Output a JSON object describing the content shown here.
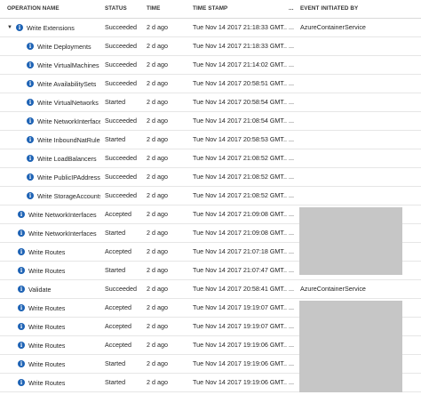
{
  "columns": {
    "operation_name": "OPERATION NAME",
    "status": "STATUS",
    "time": "TIME",
    "time_stamp": "TIME STAMP",
    "more": "...",
    "event_initiated_by": "EVENT INITIATED BY"
  },
  "rows": [
    {
      "op": "Write Extensions",
      "status": "Succeeded",
      "time": "2 d ago",
      "stamp": "Tue Nov 14 2017 21:18:33 GMT...",
      "dots": "...",
      "by": "AzureContainerService"
    },
    {
      "op": "Write Deployments",
      "status": "Succeeded",
      "time": "2 d ago",
      "stamp": "Tue Nov 14 2017 21:18:33 GMT...",
      "dots": "...",
      "by": ""
    },
    {
      "op": "Write VirtualMachines",
      "status": "Succeeded",
      "time": "2 d ago",
      "stamp": "Tue Nov 14 2017 21:14:02 GMT...",
      "dots": "...",
      "by": ""
    },
    {
      "op": "Write AvailabilitySets",
      "status": "Succeeded",
      "time": "2 d ago",
      "stamp": "Tue Nov 14 2017 20:58:51 GMT...",
      "dots": "...",
      "by": ""
    },
    {
      "op": "Write VirtualNetworks",
      "status": "Started",
      "time": "2 d ago",
      "stamp": "Tue Nov 14 2017 20:58:54 GMT...",
      "dots": "...",
      "by": ""
    },
    {
      "op": "Write NetworkInterfaces",
      "status": "Succeeded",
      "time": "2 d ago",
      "stamp": "Tue Nov 14 2017 21:08:54 GMT...",
      "dots": "...",
      "by": ""
    },
    {
      "op": "Write InboundNatRules",
      "status": "Started",
      "time": "2 d ago",
      "stamp": "Tue Nov 14 2017 20:58:53 GMT...",
      "dots": "...",
      "by": ""
    },
    {
      "op": "Write LoadBalancers",
      "status": "Succeeded",
      "time": "2 d ago",
      "stamp": "Tue Nov 14 2017 21:08:52 GMT...",
      "dots": "...",
      "by": ""
    },
    {
      "op": "Write PublicIPAddresses",
      "status": "Succeeded",
      "time": "2 d ago",
      "stamp": "Tue Nov 14 2017 21:08:52 GMT...",
      "dots": "...",
      "by": ""
    },
    {
      "op": "Write StorageAccounts",
      "status": "Succeeded",
      "time": "2 d ago",
      "stamp": "Tue Nov 14 2017 21:08:52 GMT...",
      "dots": "...",
      "by": ""
    },
    {
      "op": "Write NetworkInterfaces",
      "status": "Accepted",
      "time": "2 d ago",
      "stamp": "Tue Nov 14 2017 21:09:08 GMT...",
      "dots": "...",
      "by": ""
    },
    {
      "op": "Write NetworkInterfaces",
      "status": "Started",
      "time": "2 d ago",
      "stamp": "Tue Nov 14 2017 21:09:08 GMT...",
      "dots": "...",
      "by": ""
    },
    {
      "op": "Write Routes",
      "status": "Accepted",
      "time": "2 d ago",
      "stamp": "Tue Nov 14 2017 21:07:18 GMT...",
      "dots": "...",
      "by": ""
    },
    {
      "op": "Write Routes",
      "status": "Started",
      "time": "2 d ago",
      "stamp": "Tue Nov 14 2017 21:07:47 GMT...",
      "dots": "...",
      "by": ""
    },
    {
      "op": "Validate",
      "status": "Succeeded",
      "time": "2 d ago",
      "stamp": "Tue Nov 14 2017 20:58:41 GMT...",
      "dots": "...",
      "by": "AzureContainerService"
    },
    {
      "op": "Write Routes",
      "status": "Accepted",
      "time": "2 d ago",
      "stamp": "Tue Nov 14 2017 19:19:07 GMT...",
      "dots": "...",
      "by": ""
    },
    {
      "op": "Write Routes",
      "status": "Accepted",
      "time": "2 d ago",
      "stamp": "Tue Nov 14 2017 19:19:07 GMT...",
      "dots": "...",
      "by": ""
    },
    {
      "op": "Write Routes",
      "status": "Accepted",
      "time": "2 d ago",
      "stamp": "Tue Nov 14 2017 19:19:06 GMT...",
      "dots": "...",
      "by": ""
    },
    {
      "op": "Write Routes",
      "status": "Started",
      "time": "2 d ago",
      "stamp": "Tue Nov 14 2017 19:19:06 GMT...",
      "dots": "...",
      "by": ""
    },
    {
      "op": "Write Routes",
      "status": "Started",
      "time": "2 d ago",
      "stamp": "Tue Nov 14 2017 19:19:06 GMT...",
      "dots": "...",
      "by": ""
    }
  ],
  "icons": {
    "info": "info-icon",
    "expand": "caret-down-icon",
    "info_glyph": "i",
    "caret_glyph": "▼"
  },
  "colors": {
    "info_icon": "#1e63b5",
    "redaction": "#c6c6c6",
    "row_divider": "#e6e6e6"
  }
}
